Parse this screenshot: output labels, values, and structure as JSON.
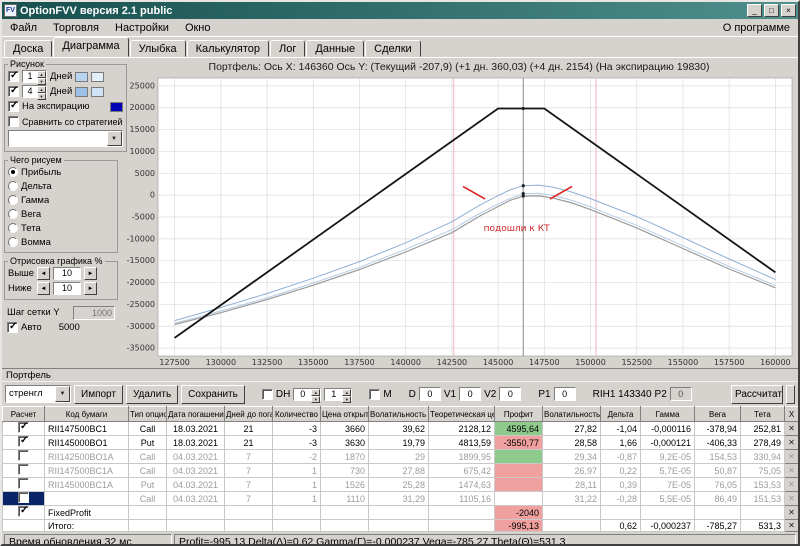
{
  "window": {
    "title": "OptionFVV версия 2.1 public",
    "icon_text": "FV",
    "controls": [
      "_",
      "□",
      "×"
    ]
  },
  "menu": {
    "items": [
      "Файл",
      "Торговля",
      "Настройки",
      "Окно"
    ],
    "right": "О программе"
  },
  "tabs": {
    "items": [
      "Доска",
      "Диаграмма",
      "Улыбка",
      "Калькулятор",
      "Лог",
      "Данные",
      "Сделки"
    ],
    "active": "Диаграмма"
  },
  "sidebar": {
    "group1_label": "Рисунок",
    "day_rows": [
      {
        "value": "1",
        "label": "Дней",
        "colors": [
          "#b8d4f0",
          "#e2eefa"
        ]
      },
      {
        "value": "4",
        "label": "Дней",
        "colors": [
          "#9cc0e8",
          "#cfe2f6"
        ]
      }
    ],
    "expiration": {
      "label": "На экспирацию",
      "color": "#0000b4"
    },
    "compare_label": "Сравнить со стратегией",
    "compare_value": "",
    "draw_group": {
      "label": "Чего рисуем",
      "options": [
        "Прибыль",
        "Дельта",
        "Гамма",
        "Вега",
        "Тета",
        "Вомма"
      ],
      "selected": "Прибыль"
    },
    "render_group": {
      "label": "Отрисовка графика %",
      "above_label": "Выше",
      "above_value": "10",
      "below_label": "Ниже",
      "below_value": "10"
    },
    "grid_step": {
      "label": "Шаг сетки Y",
      "value": "1000",
      "auto_label": "Авто",
      "auto_value": "5000"
    }
  },
  "chart_data": {
    "type": "line",
    "title": "Портфель:  Ось X: 146360  Ось Y:  (Текущий -207,9)  (+1 дн. 360,03)  (+4 дн. 2154)  (На экспирацию 19830)",
    "xlim": [
      126600,
      160900
    ],
    "ylim": [
      -36800,
      26800
    ],
    "x_ticks": [
      127500,
      130000,
      132500,
      135000,
      137500,
      140000,
      142500,
      145000,
      147500,
      150000,
      152500,
      155000,
      157500,
      160000
    ],
    "y_ticks": [
      25000,
      20000,
      15000,
      10000,
      5000,
      0,
      -5000,
      -10000,
      -15000,
      -20000,
      -25000,
      -30000,
      -35000
    ],
    "grid": true,
    "series": [
      {
        "name": "+4 дн.",
        "color": "#8fb0d4",
        "width": 1,
        "points": [
          [
            127500,
            -28700
          ],
          [
            130000,
            -25700
          ],
          [
            132500,
            -22500
          ],
          [
            135000,
            -19000
          ],
          [
            137500,
            -15200
          ],
          [
            140000,
            -10900
          ],
          [
            142500,
            -6100
          ],
          [
            144000,
            -2300
          ],
          [
            145000,
            -100
          ],
          [
            145700,
            1300
          ],
          [
            146360,
            2154
          ],
          [
            147200,
            2300
          ],
          [
            148000,
            1800
          ],
          [
            149000,
            700
          ],
          [
            150000,
            -800
          ],
          [
            152500,
            -4900
          ],
          [
            155000,
            -9700
          ],
          [
            157500,
            -14600
          ],
          [
            160000,
            -19300
          ]
        ]
      },
      {
        "name": "+1 дн.",
        "color": "#b4cce6",
        "width": 1,
        "points": [
          [
            127500,
            -29300
          ],
          [
            130000,
            -26500
          ],
          [
            132500,
            -23500
          ],
          [
            135000,
            -20100
          ],
          [
            137500,
            -16500
          ],
          [
            140000,
            -12400
          ],
          [
            142500,
            -7900
          ],
          [
            144000,
            -4200
          ],
          [
            145000,
            -2000
          ],
          [
            145700,
            -700
          ],
          [
            146360,
            360
          ],
          [
            147200,
            420
          ],
          [
            148000,
            -100
          ],
          [
            149000,
            -1200
          ],
          [
            150000,
            -2700
          ],
          [
            152500,
            -6900
          ],
          [
            155000,
            -11600
          ],
          [
            157500,
            -16300
          ],
          [
            160000,
            -20700
          ]
        ]
      },
      {
        "name": "Текущий",
        "color": "#9a9a9a",
        "width": 1.2,
        "points": [
          [
            127500,
            -29600
          ],
          [
            130000,
            -26900
          ],
          [
            132500,
            -23900
          ],
          [
            135000,
            -20600
          ],
          [
            137500,
            -17000
          ],
          [
            140000,
            -13000
          ],
          [
            142500,
            -8600
          ],
          [
            144000,
            -4800
          ],
          [
            145000,
            -2600
          ],
          [
            145700,
            -1100
          ],
          [
            146360,
            -208
          ],
          [
            147200,
            -180
          ],
          [
            148000,
            -700
          ],
          [
            149000,
            -1800
          ],
          [
            150000,
            -3300
          ],
          [
            152500,
            -7500
          ],
          [
            155000,
            -12200
          ],
          [
            157500,
            -16900
          ],
          [
            160000,
            -21200
          ]
        ]
      },
      {
        "name": "На экспирацию",
        "color": "#151515",
        "width": 1.8,
        "points": [
          [
            127500,
            -32670
          ],
          [
            145000,
            19830
          ],
          [
            147500,
            19830
          ],
          [
            160000,
            -17670
          ]
        ]
      }
    ],
    "vlines": [
      {
        "x": 142600,
        "color": "#f0b4c4"
      },
      {
        "x": 150300,
        "color": "#f0b4c4"
      },
      {
        "x": 146360,
        "color": "#8a8a8a"
      }
    ],
    "markers": [
      [
        146360,
        -208
      ],
      [
        146360,
        360
      ],
      [
        146360,
        2154
      ],
      [
        146360,
        19830
      ]
    ],
    "red_marks": [
      [
        [
          143100,
          2000
        ],
        [
          144300,
          -900
        ]
      ],
      [
        [
          147800,
          -900
        ],
        [
          149000,
          2000
        ]
      ]
    ],
    "annotations": [
      {
        "text": "подошли к КТ",
        "x": 146000,
        "y": -8200,
        "color": "#cc2222"
      }
    ]
  },
  "portfolio": {
    "section_label": "Портфель",
    "strategy_value": "стренгл",
    "buttons": [
      "Импорт",
      "Удалить",
      "Сохранить"
    ],
    "dh_label": "DH",
    "dh_values": [
      "0",
      "1"
    ],
    "m_label": "M",
    "fields": [
      {
        "label": "D",
        "value": "0"
      },
      {
        "label": "V1",
        "value": "0"
      },
      {
        "label": "V2",
        "value": "0"
      },
      {
        "label": "P1",
        "value": "0"
      }
    ],
    "instrument_label": "RIH1 143340",
    "p2_label": "P2",
    "p2_value": "0",
    "calc_button": "Рассчитать",
    "table": {
      "headers": [
        "Расчет",
        "Код бумаги",
        "Тип опциона",
        "Дата погашения",
        "Дней до погашения",
        "Количество",
        "Цена открытия",
        "Волатильность открытия",
        "Теоретическая цена",
        "Профит",
        "Волатильность",
        "Дельта",
        "Гамма",
        "Вега",
        "Тета",
        "X"
      ],
      "rows": [
        {
          "check": "on",
          "gray": false,
          "sel": false,
          "profit_bg": "green",
          "cells": [
            "RII147500BC1",
            "Call",
            "18.03.2021",
            "21",
            "-3",
            "3660",
            "39,62",
            "2128,12",
            "4595,64",
            "27,82",
            "-1,04",
            "-0,000116",
            "-378,94",
            "252,81"
          ]
        },
        {
          "check": "on",
          "gray": false,
          "sel": false,
          "profit_bg": "red",
          "cells": [
            "RII145000BO1",
            "Put",
            "18.03.2021",
            "21",
            "-3",
            "3630",
            "19,79",
            "4813,59",
            "-3550,77",
            "28,58",
            "1,66",
            "-0,000121",
            "-406,33",
            "278,49"
          ]
        },
        {
          "check": "off",
          "gray": true,
          "sel": false,
          "profit_bg": "green",
          "cells": [
            "RII142500BO1A",
            "Call",
            "04.03.2021",
            "7",
            "-2",
            "1870",
            "29",
            "1899,95",
            "",
            "29,34",
            "-0,87",
            "9,2E-05",
            "154,53",
            "330,94"
          ]
        },
        {
          "check": "off",
          "gray": true,
          "sel": false,
          "profit_bg": "red",
          "cells": [
            "RII147500BC1A",
            "Call",
            "04.03.2021",
            "7",
            "1",
            "730",
            "27,88",
            "675,42",
            "",
            "26,97",
            "0,22",
            "5,7E-05",
            "50,87",
            "75,05"
          ]
        },
        {
          "check": "off",
          "gray": true,
          "sel": false,
          "profit_bg": "red",
          "cells": [
            "RII145000BC1A",
            "Put",
            "04.03.2021",
            "7",
            "1",
            "1526",
            "25,28",
            "1474,63",
            "",
            "28,11",
            "0,39",
            "7E-05",
            "76,05",
            "153,53"
          ]
        },
        {
          "check": "off",
          "gray": true,
          "sel": true,
          "profit_bg": "none",
          "cells": [
            "",
            "Call",
            "04.03.2021",
            "7",
            "1",
            "1110",
            "31,29",
            "1105,16",
            "",
            "31,22",
            "-0,28",
            "5,5E-05",
            "86,49",
            "151,53"
          ]
        },
        {
          "check": "on",
          "gray": false,
          "sel": false,
          "profit_bg": "red",
          "cells": [
            "FixedProfit",
            "",
            "",
            "",
            "",
            "",
            "",
            "",
            "-2040",
            "",
            "",
            "",
            "",
            ""
          ]
        },
        {
          "check": "none",
          "gray": false,
          "sel": false,
          "profit_bg": "red",
          "cells": [
            "Итого:",
            "",
            "",
            "",
            "",
            "",
            "",
            "",
            "-995,13",
            "",
            "0,62",
            "-0,000237",
            "-785,27",
            "531,3"
          ]
        }
      ]
    }
  },
  "statusbar": {
    "left": "Время обновления 32 мс",
    "right": "Profit=-995,13 Delta(Δ)=0,62 Gamma(Γ)=-0,000237 Vega=-785,27 Theta(Θ)=531,3"
  }
}
